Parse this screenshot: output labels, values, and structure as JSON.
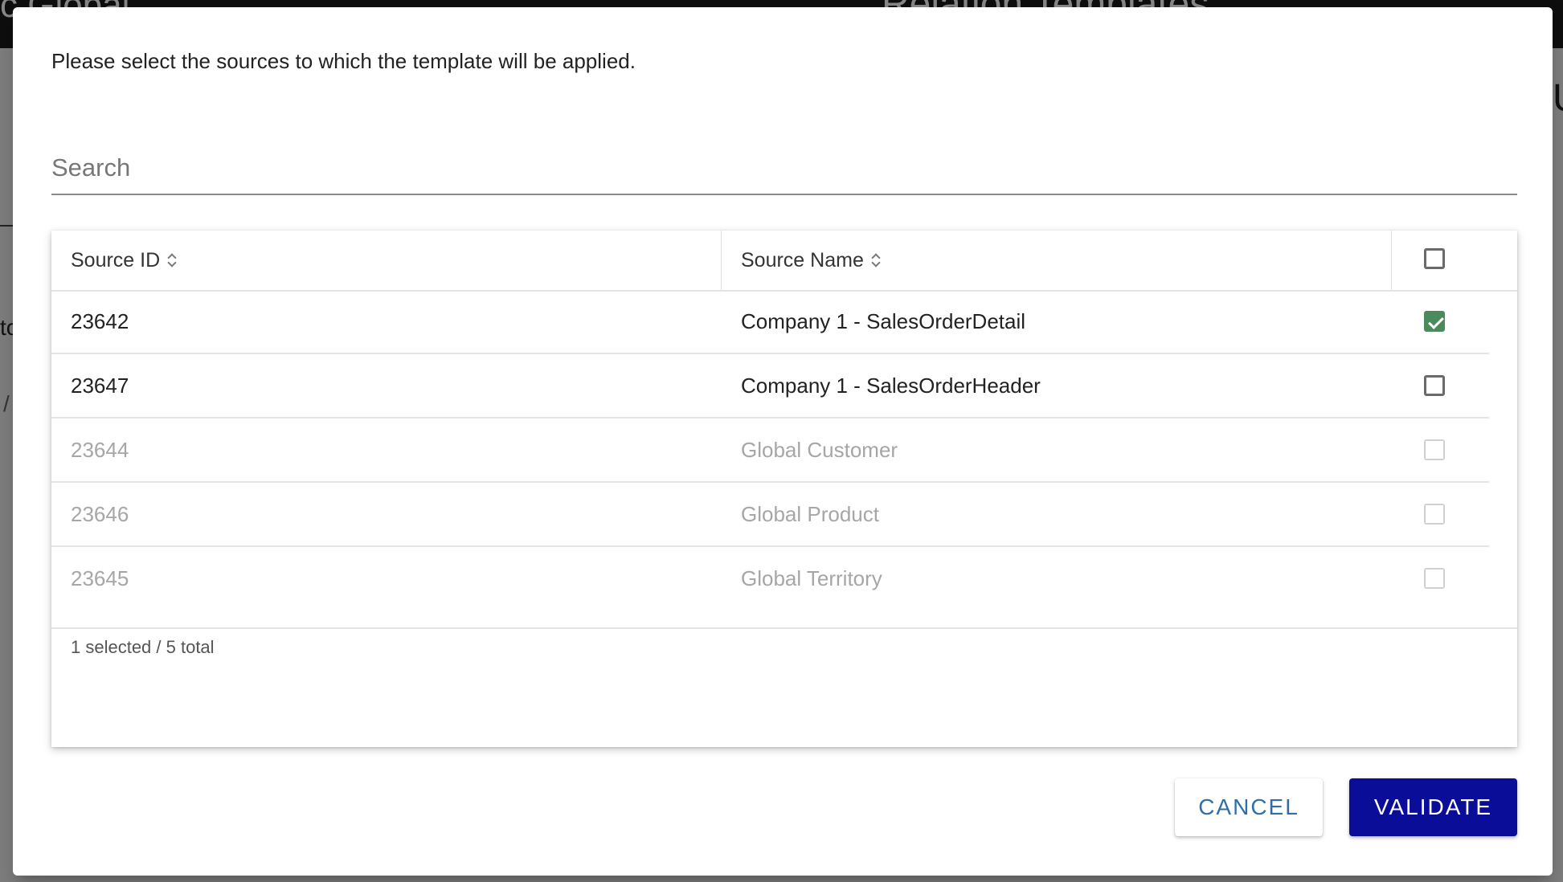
{
  "background": {
    "topbar_left_fragment": "c  Global",
    "topbar_right_fragment": "Relation Templates",
    "side_fragment": "to",
    "side_fragment_2": "/",
    "right_fragment": "U"
  },
  "dialog": {
    "prompt": "Please select the sources to which the template will be applied.",
    "search": {
      "placeholder": "Search",
      "value": ""
    },
    "table": {
      "columns": {
        "source_id": "Source ID",
        "source_name": "Source Name"
      },
      "select_all_checked": false,
      "rows": [
        {
          "id": "23642",
          "name": "Company 1 - SalesOrderDetail",
          "checked": true,
          "disabled": false
        },
        {
          "id": "23647",
          "name": "Company 1 - SalesOrderHeader",
          "checked": false,
          "disabled": false
        },
        {
          "id": "23644",
          "name": "Global Customer",
          "checked": false,
          "disabled": true
        },
        {
          "id": "23646",
          "name": "Global Product",
          "checked": false,
          "disabled": true
        },
        {
          "id": "23645",
          "name": "Global Territory",
          "checked": false,
          "disabled": true
        }
      ],
      "footer": "1 selected / 5 total"
    },
    "buttons": {
      "cancel": "CANCEL",
      "validate": "VALIDATE"
    }
  },
  "colors": {
    "validate_bg": "#0a0d98",
    "cancel_text": "#2f6eaa",
    "checkbox_checked": "#4a8a5b"
  }
}
